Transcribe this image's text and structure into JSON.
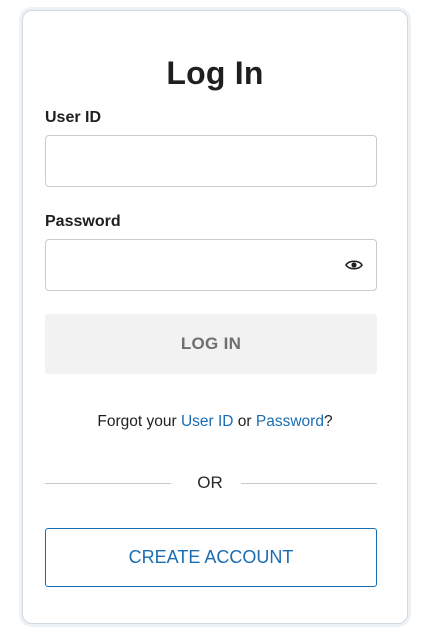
{
  "login": {
    "title": "Log In",
    "user_id_label": "User ID",
    "user_id_value": "",
    "password_label": "Password",
    "password_value": "",
    "show_password_icon": "eye-icon",
    "login_button": "LOG IN",
    "forgot_prefix": "Forgot your ",
    "forgot_user_id_link": "User ID",
    "forgot_or": " or ",
    "forgot_password_link": "Password",
    "forgot_suffix": "?",
    "separator": "OR",
    "create_account_button": "CREATE ACCOUNT"
  },
  "colors": {
    "link_blue": "#1a6db3",
    "disabled_button_bg": "#f2f2f2",
    "disabled_button_text": "#6f6f6f",
    "border": "#cfd8df"
  }
}
